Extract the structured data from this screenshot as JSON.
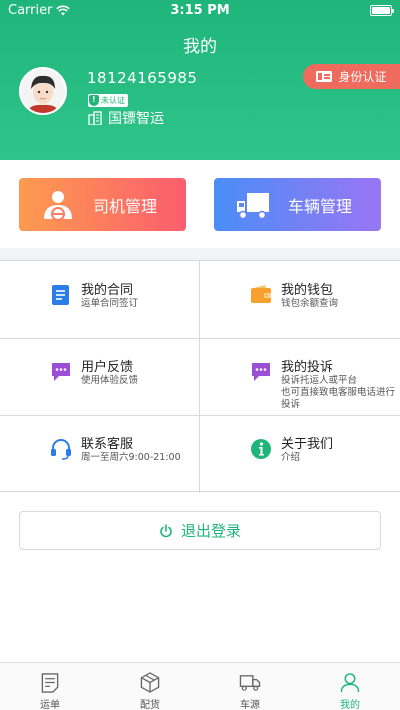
{
  "status_bar": {
    "carrier": "Carrier",
    "time": "3:15 PM"
  },
  "header": {
    "title": "我的",
    "phone": "18124165985",
    "verify_badge": "未认证",
    "company": "国镖智运",
    "id_button": "身份认证"
  },
  "actions": {
    "driver": "司机管理",
    "vehicle": "车辆管理"
  },
  "menu": [
    {
      "title": "我的合同",
      "sub": "运单合同签订",
      "icon": "document-icon"
    },
    {
      "title": "我的钱包",
      "sub": "钱包余额查询",
      "icon": "wallet-icon"
    },
    {
      "title": "用户反馈",
      "sub": "使用体验反馈",
      "icon": "chat-icon"
    },
    {
      "title": "我的投诉",
      "sub": "投诉托运人或平台\n也可直接致电客服电话进行投诉",
      "icon": "complaint-icon"
    },
    {
      "title": "联系客服",
      "sub": "周一至周六9:00-21:00",
      "icon": "headset-icon"
    },
    {
      "title": "关于我们",
      "sub": "介绍",
      "icon": "info-icon"
    }
  ],
  "logout_label": "退出登录",
  "tabs": [
    {
      "label": "运单",
      "icon": "waybill-icon"
    },
    {
      "label": "配货",
      "icon": "box-icon"
    },
    {
      "label": "车源",
      "icon": "truck-icon"
    },
    {
      "label": "我的",
      "icon": "user-icon",
      "active": true
    }
  ],
  "colors": {
    "brand": "#1fb57a",
    "id_button": "#ee6b5e",
    "driver_gradient": [
      "#fe9b4f",
      "#fb5e6e"
    ],
    "vehicle_gradient": [
      "#4a8df6",
      "#9a76f3"
    ]
  }
}
